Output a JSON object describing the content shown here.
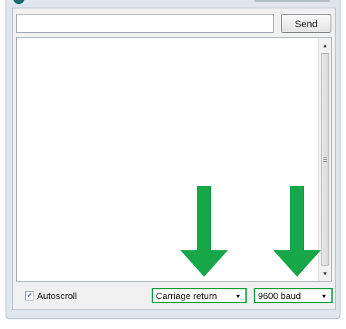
{
  "input": {
    "value": "",
    "placeholder": ""
  },
  "toolbar": {
    "send_label": "Send"
  },
  "output": {
    "text": ""
  },
  "scroll": {
    "up_glyph": "▲",
    "down_glyph": "▼"
  },
  "bottom": {
    "autoscroll_label": "Autoscroll",
    "autoscroll_checked": true,
    "check_glyph": "✓",
    "line_ending": "Carriage return",
    "baud_rate": "9600 baud",
    "caret_glyph": "▼"
  },
  "colors": {
    "highlight": "#1da64a",
    "arrow": "#17a648"
  }
}
